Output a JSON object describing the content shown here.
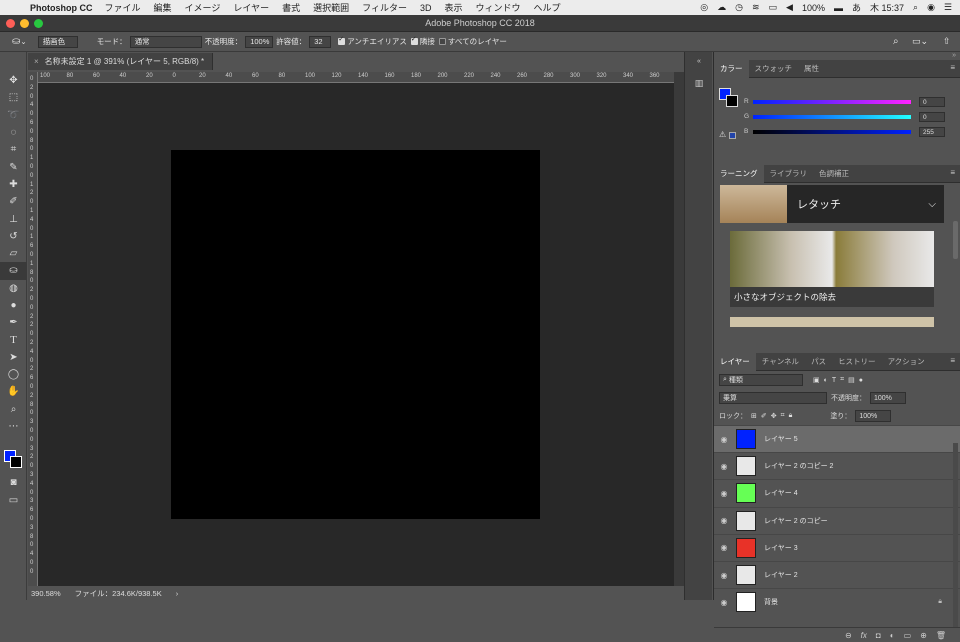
{
  "menubar": {
    "app_name": "Photoshop CC",
    "items": [
      "ファイル",
      "編集",
      "イメージ",
      "レイヤー",
      "書式",
      "選択範囲",
      "フィルター",
      "3D",
      "表示",
      "ウィンドウ",
      "ヘルプ"
    ],
    "battery": "100%",
    "input_mode": "あ",
    "clock": "木 15:37"
  },
  "window": {
    "title": "Adobe Photoshop CC 2018"
  },
  "options_bar": {
    "fill_source": "描画色",
    "mode_label": "モード：",
    "mode_value": "通常",
    "opacity_label": "不透明度：",
    "opacity_value": "100%",
    "tolerance_label": "許容値：",
    "tolerance_value": "32",
    "antialias_label": "アンチエイリアス",
    "contiguous_label": "隣接",
    "all_layers_label": "すべてのレイヤー"
  },
  "document": {
    "tab_title": "名称未設定 1 @ 391% (レイヤー 5, RGB/8) *"
  },
  "ruler": {
    "h_ticks": [
      "100",
      "80",
      "60",
      "40",
      "20",
      "0",
      "20",
      "40",
      "60",
      "80",
      "100",
      "120",
      "140",
      "160",
      "180",
      "200",
      "220",
      "240",
      "260",
      "280",
      "300",
      "320",
      "340",
      "360"
    ],
    "v_ticks": [
      "0",
      "2",
      "0",
      "4",
      "0",
      "6",
      "0",
      "8",
      "0",
      "1",
      "0",
      "0",
      "1",
      "2",
      "0",
      "1",
      "4",
      "0",
      "1",
      "6",
      "0",
      "1",
      "8",
      "0",
      "2",
      "0",
      "0",
      "2",
      "2",
      "0",
      "2",
      "4",
      "0",
      "2",
      "6",
      "0",
      "2",
      "8",
      "0",
      "3",
      "0",
      "0",
      "3",
      "2",
      "0",
      "3",
      "4",
      "0",
      "3",
      "6",
      "0",
      "3",
      "8",
      "0",
      "4",
      "0",
      "0"
    ]
  },
  "status": {
    "zoom": "390.58%",
    "file_info": "ファイル：234.6K/938.5K"
  },
  "color_panel": {
    "tabs": [
      "カラー",
      "スウォッチ",
      "属性"
    ],
    "channels": [
      {
        "name": "R",
        "value": "0"
      },
      {
        "name": "G",
        "value": "0"
      },
      {
        "name": "B",
        "value": "255"
      }
    ],
    "foreground": "#0022ff",
    "background": "#000000"
  },
  "learn_panel": {
    "tabs": [
      "ラーニング",
      "ライブラリ",
      "色調補正"
    ],
    "banner_title": "レタッチ",
    "card_caption": "小さなオブジェクトの除去"
  },
  "layers_panel": {
    "tabs": [
      "レイヤー",
      "チャンネル",
      "パス",
      "ヒストリー",
      "アクション"
    ],
    "filter_kind": "種類",
    "blend_mode": "乗算",
    "opacity_label": "不透明度：",
    "opacity_value": "100%",
    "lock_label": "ロック：",
    "fill_label": "塗り：",
    "fill_value": "100%",
    "layers": [
      {
        "name": "レイヤー 5",
        "thumb_color": "#0022ff",
        "selected": true
      },
      {
        "name": "レイヤー 2 のコピー 2",
        "thumb_color": "#e8e8e8",
        "selected": false
      },
      {
        "name": "レイヤー 4",
        "thumb_color": "#66ff55",
        "selected": false
      },
      {
        "name": "レイヤー 2 のコピー",
        "thumb_color": "#e8e8e8",
        "selected": false
      },
      {
        "name": "レイヤー 3",
        "thumb_color": "#e83228",
        "selected": false
      },
      {
        "name": "レイヤー 2",
        "thumb_color": "#e8e8e8",
        "selected": false
      },
      {
        "name": "背景",
        "thumb_color": "#ffffff",
        "selected": false
      }
    ]
  }
}
